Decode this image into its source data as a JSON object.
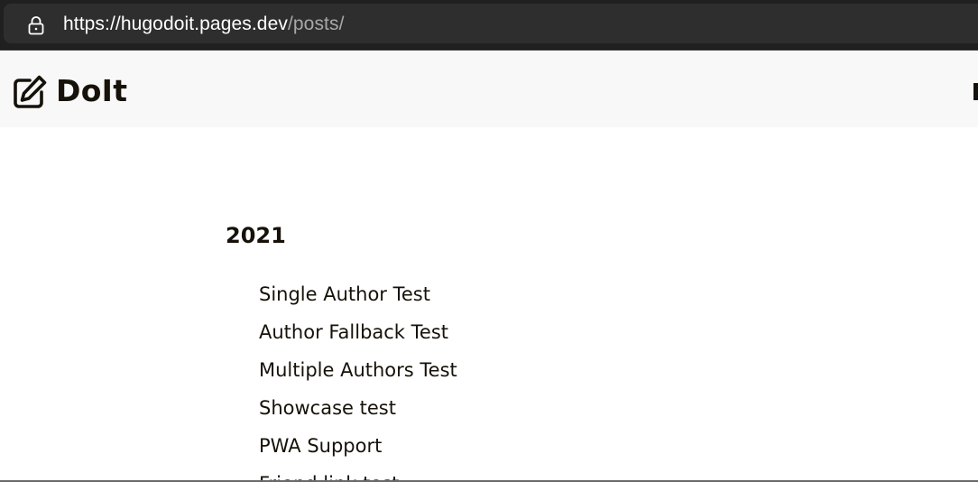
{
  "browser": {
    "url_scheme": "https://",
    "url_host": "hugodoit.pages.dev",
    "url_path": "/posts/",
    "lock_icon": "lock-icon"
  },
  "header": {
    "logo_icon": "edit-icon",
    "site_title": "DoIt"
  },
  "archive": {
    "year": "2021",
    "posts": [
      "Single Author Test",
      "Author Fallback Test",
      "Multiple Authors Test",
      "Showcase test",
      "PWA Support",
      "Friend link test"
    ]
  },
  "colors": {
    "chrome_bg": "#202020",
    "address_bg": "#2e2e2e",
    "header_bg": "#f8f8f8",
    "text": "#161209"
  }
}
